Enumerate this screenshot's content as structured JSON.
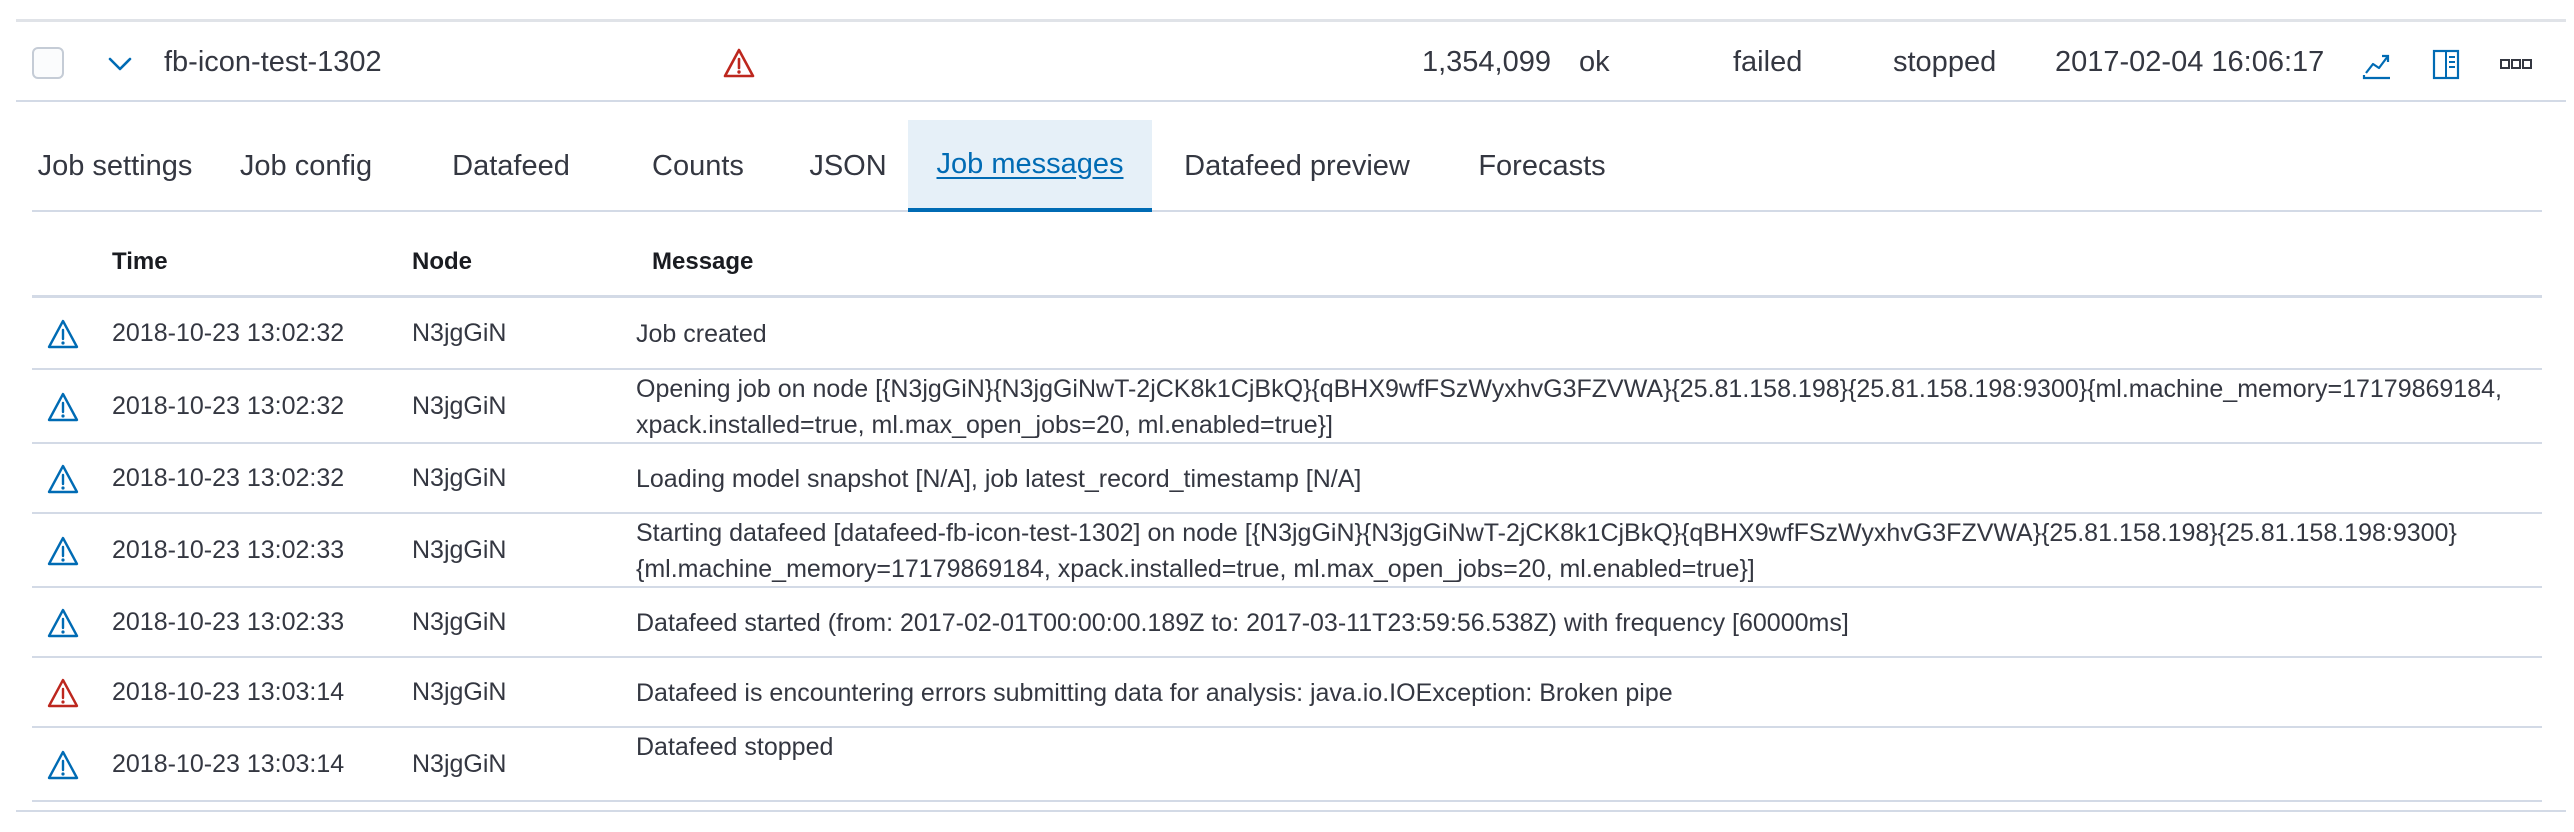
{
  "job": {
    "id": "fb-icon-test-1302",
    "processed_records": "1,354,099",
    "memory_status": "ok",
    "job_state": "failed",
    "datafeed_state": "stopped",
    "latest_timestamp": "2017-02-04 16:06:17",
    "icons": {
      "checkbox": "checkbox-icon",
      "expand": "chevron-down-icon",
      "warning": "warning-triangle-icon",
      "actions": [
        "anomaly-chart-icon",
        "single-metric-viewer-icon",
        "more-actions-icon"
      ]
    }
  },
  "tabs": [
    {
      "label": "Job settings"
    },
    {
      "label": "Job config"
    },
    {
      "label": "Datafeed"
    },
    {
      "label": "Counts"
    },
    {
      "label": "JSON"
    },
    {
      "label": "Job messages",
      "active": true
    },
    {
      "label": "Datafeed preview"
    },
    {
      "label": "Forecasts"
    }
  ],
  "messages": {
    "columns": {
      "time": "Time",
      "node": "Node",
      "message": "Message"
    },
    "rows": [
      {
        "level": "info",
        "time": "2018-10-23 13:02:32",
        "node": "N3jgGiN",
        "message": "Job created"
      },
      {
        "level": "info",
        "time": "2018-10-23 13:02:32",
        "node": "N3jgGiN",
        "message": "Opening job on node [{N3jgGiN}{N3jgGiNwT-2jCK8k1CjBkQ}{qBHX9wfFSzWyxhvG3FZVWA}{25.81.158.198}{25.81.158.198:9300}{ml.machine_memory=17179869184, xpack.installed=true, ml.max_open_jobs=20, ml.enabled=true}]"
      },
      {
        "level": "info",
        "time": "2018-10-23 13:02:32",
        "node": "N3jgGiN",
        "message": "Loading model snapshot [N/A], job latest_record_timestamp [N/A]"
      },
      {
        "level": "info",
        "time": "2018-10-23 13:02:33",
        "node": "N3jgGiN",
        "message": "Starting datafeed [datafeed-fb-icon-test-1302] on node [{N3jgGiN}{N3jgGiNwT-2jCK8k1CjBkQ}{qBHX9wfFSzWyxhvG3FZVWA}{25.81.158.198}{25.81.158.198:9300}{ml.machine_memory=17179869184, xpack.installed=true, ml.max_open_jobs=20, ml.enabled=true}]"
      },
      {
        "level": "info",
        "time": "2018-10-23 13:02:33",
        "node": "N3jgGiN",
        "message": "Datafeed started (from: 2017-02-01T00:00:00.189Z to: 2017-03-11T23:59:56.538Z) with frequency [60000ms]"
      },
      {
        "level": "error",
        "time": "2018-10-23 13:03:14",
        "node": "N3jgGiN",
        "message": "Datafeed is encountering errors submitting data for analysis: java.io.IOException: Broken pipe"
      },
      {
        "level": "info",
        "time": "2018-10-23 13:03:14",
        "node": "N3jgGiN",
        "message": "Datafeed stopped"
      }
    ]
  },
  "colors": {
    "info_icon": "#006bb4",
    "error_icon": "#bd271e",
    "active_tab_bg": "#e6f0f8",
    "link": "#006bb4",
    "border": "#d3dae6"
  }
}
